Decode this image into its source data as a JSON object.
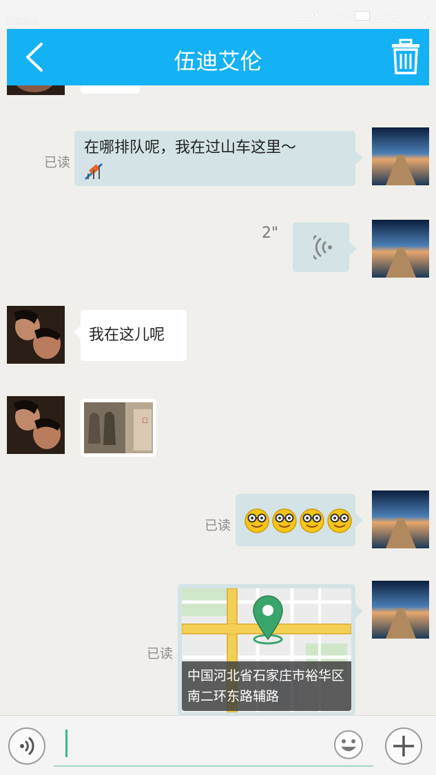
{
  "status_bar": {
    "carrier": "中国移动",
    "speed": "1.9K/s",
    "time": "上午9:04"
  },
  "header": {
    "title": "伍迪艾伦",
    "back_icon": "chevron-left-icon",
    "delete_icon": "trash-icon"
  },
  "messages": [
    {
      "side": "me",
      "type": "text",
      "text": "在哪排队呢，我在过山车这里～",
      "status": "已读",
      "emoji": "roller-coaster-emoji"
    },
    {
      "side": "me",
      "type": "voice",
      "duration": "2\"",
      "icon": "voice-wave-icon"
    },
    {
      "side": "them",
      "type": "text",
      "text": "我在这儿呢"
    },
    {
      "side": "them",
      "type": "image",
      "icon": "photo-thumbnail"
    },
    {
      "side": "me",
      "type": "emoji",
      "status": "已读",
      "emoji": "nerd-face-emoji",
      "count": 4
    },
    {
      "side": "me",
      "type": "location",
      "status": "已读",
      "address": "中国河北省石家庄市裕华区南二环东路辅路",
      "icon": "map-pin-icon"
    }
  ],
  "input_bar": {
    "voice_icon": "voice-icon",
    "emoji_icon": "smiley-icon",
    "add_icon": "plus-icon",
    "value": ""
  },
  "colors": {
    "header_bg": "#15b1f5",
    "my_bubble": "#d3e3e6",
    "their_bubble": "#ffffff",
    "background": "#f0efeb"
  }
}
